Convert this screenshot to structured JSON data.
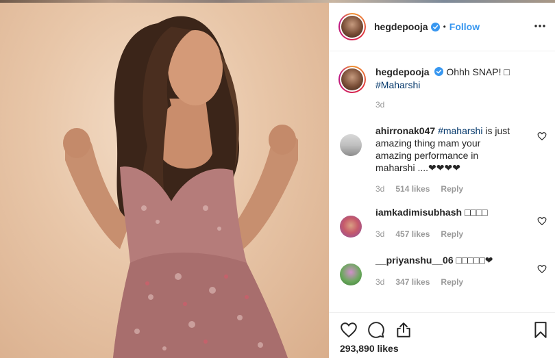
{
  "post": {
    "username": "hegdepooja",
    "separator": "•",
    "follow_label": "Follow",
    "caption_text": "Ohhh SNAP! ",
    "caption_emoji": "□",
    "caption_hashtag": "#Maharshi",
    "caption_age": "3d",
    "likes_total": "293,890 likes"
  },
  "comments": [
    {
      "username": "ahirronak047",
      "hashtag": "#maharshi",
      "text": " is just amazing thing mam your amazing performance in maharshi ....❤❤❤❤",
      "age": "3d",
      "likes": "514 likes",
      "reply": "Reply"
    },
    {
      "username": "iamkadimisubhash",
      "text": "□□□□",
      "age": "3d",
      "likes": "457 likes",
      "reply": "Reply"
    },
    {
      "username": "__priyanshu__06",
      "text": "□□□□□❤",
      "age": "3d",
      "likes": "347 likes",
      "reply": "Reply"
    }
  ],
  "colors": {
    "link_blue": "#3897f0",
    "hashtag_blue": "#003569",
    "verified_blue": "#3897f0",
    "muted_gray": "#999999"
  },
  "icons": [
    "verified-badge-icon",
    "more-options-icon",
    "heart-icon",
    "comment-icon",
    "share-icon",
    "bookmark-icon"
  ]
}
